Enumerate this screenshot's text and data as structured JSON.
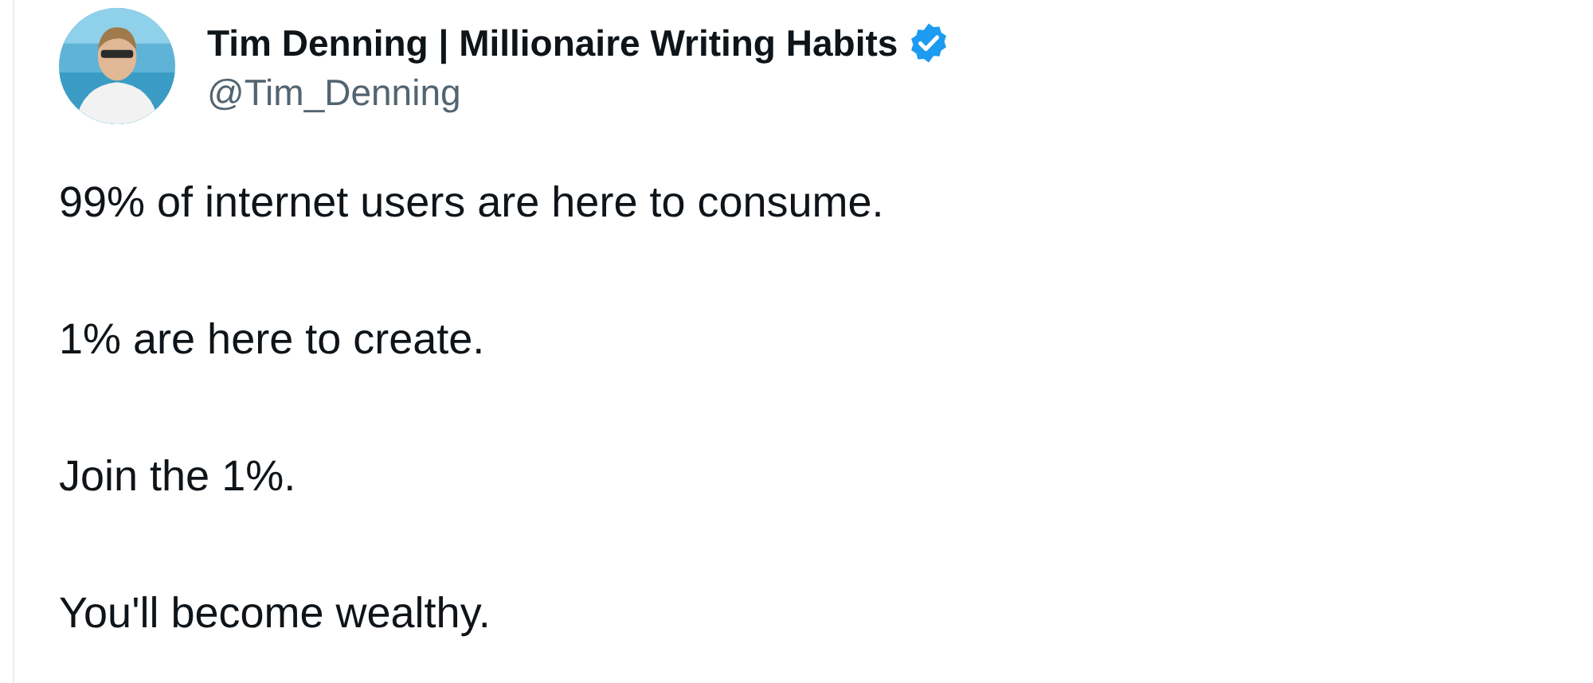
{
  "author": {
    "name": "Tim Denning | Millionaire Writing Habits",
    "handle": "@Tim_Denning",
    "verified": true
  },
  "paragraphs": [
    "99% of internet users are here to consume.",
    "1% are here to create.",
    "Join the 1%.",
    "You'll become wealthy."
  ]
}
